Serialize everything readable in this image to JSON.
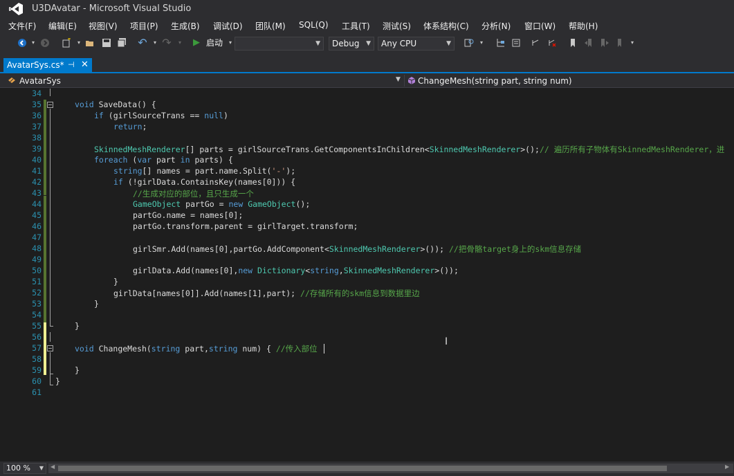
{
  "window": {
    "title": "U3DAvatar - Microsoft Visual Studio"
  },
  "menu": [
    "文件(F)",
    "编辑(E)",
    "视图(V)",
    "项目(P)",
    "生成(B)",
    "调试(D)",
    "团队(M)",
    "SQL(Q)",
    "工具(T)",
    "测试(S)",
    "体系结构(C)",
    "分析(N)",
    "窗口(W)",
    "帮助(H)"
  ],
  "toolbar": {
    "start_label": "启动",
    "target_value": "",
    "config_value": "Debug",
    "platform_value": "Any CPU"
  },
  "tab": {
    "label": "AvatarSys.cs*",
    "pin": "⊣",
    "close": "✕"
  },
  "nav": {
    "class_label": "AvatarSys",
    "member_label": "ChangeMesh(string part, string num)"
  },
  "editor": {
    "line_numbers": [
      "34",
      "35",
      "36",
      "37",
      "38",
      "39",
      "40",
      "41",
      "42",
      "43",
      "44",
      "45",
      "46",
      "47",
      "48",
      "49",
      "50",
      "51",
      "52",
      "53",
      "54",
      "55",
      "56",
      "57",
      "58",
      "59",
      "60",
      "61"
    ],
    "lines": {
      "l35": {
        "kw": "void",
        "rest": " SaveData() {"
      },
      "l36": {
        "kw": "if",
        "a": " (girlSourceTrans == ",
        "kw2": "null",
        "b": ")"
      },
      "l37": {
        "kw": "return",
        "rest": ";"
      },
      "l39": {
        "t1": "SkinnedMeshRenderer",
        "a": "[] parts = girlSourceTrans.GetComponentsInChildren<",
        "t2": "SkinnedMeshRenderer",
        "b": ">();",
        "c": "// 遍历所有子物体有SkinnedMeshRenderer，进"
      },
      "l40": {
        "kw": "foreach",
        "a": " (",
        "kw2": "var",
        "b": " part ",
        "kw3": "in",
        "c": " parts) {"
      },
      "l41": {
        "kw": "string",
        "a": "[] names = part.name.Split(",
        "s": "'-'",
        "b": ");"
      },
      "l42": {
        "kw": "if",
        "rest": " (!girlData.ContainsKey(names[0])) {"
      },
      "l43": {
        "c": "//生成对应的部位，且只生成一个"
      },
      "l44": {
        "t1": "GameObject",
        "a": " partGo = ",
        "kw": "new",
        "sp": " ",
        "t2": "GameObject",
        "b": "();"
      },
      "l45": {
        "rest": "partGo.name = names[0];"
      },
      "l46": {
        "rest": "partGo.transform.parent = girlTarget.transform;"
      },
      "l48": {
        "a": "girlSmr.Add(names[0],partGo.AddComponent<",
        "t": "SkinnedMeshRenderer",
        "b": ">()); ",
        "c": "//把骨骼target身上的skm信息存储"
      },
      "l50": {
        "a": "girlData.Add(names[0],",
        "kw": "new",
        "sp": " ",
        "t1": "Dictionary",
        "lt": "<",
        "kw2": "string",
        "cm": ",",
        "t2": "SkinnedMeshRenderer",
        "b": ">());"
      },
      "l51": {
        "rest": "}"
      },
      "l52": {
        "a": "girlData[names[0]].Add(names[1],part); ",
        "c": "//存储所有的skm信息到数据里边"
      },
      "l53": {
        "rest": "}"
      },
      "l55": {
        "rest": "}"
      },
      "l57": {
        "kw": "void",
        "a": " ChangeMesh(",
        "kw2": "string",
        "b": " part,",
        "kw3": "string",
        "c": " num) { ",
        "cm": "//传入部位"
      },
      "l59": {
        "rest": "}"
      },
      "l60": {
        "rest": "}"
      }
    }
  },
  "status": {
    "zoom": "100 %"
  }
}
